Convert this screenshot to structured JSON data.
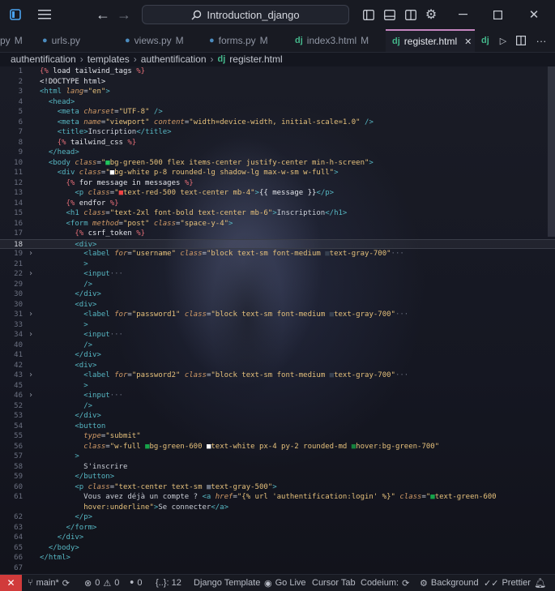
{
  "titlebar": {
    "search_text": "Introduction_django"
  },
  "tabs": [
    {
      "label": "py",
      "modified": "M",
      "icon": "python-icon"
    },
    {
      "label": "urls.py",
      "modified": "",
      "icon": "python-icon"
    },
    {
      "label": "views.py",
      "modified": "M",
      "icon": "python-icon"
    },
    {
      "label": "forms.py",
      "modified": "M",
      "icon": "python-icon"
    },
    {
      "label": "index3.html",
      "modified": "M",
      "icon": "django-icon"
    },
    {
      "label": "register.html",
      "modified": "",
      "icon": "django-icon",
      "active": true
    }
  ],
  "icons": {
    "django_prefix": "dj",
    "python_glyph": "●",
    "close": "✕"
  },
  "breadcrumb": [
    "authentification",
    "templates",
    "authentification",
    "register.html"
  ],
  "editor": {
    "lines": [
      {
        "n": "1",
        "html": "<span class='dt'>{%</span> <span class='k'>load tailwind_tags</span> <span class='dt'>%}</span>"
      },
      {
        "n": "2",
        "html": "<span class='k'>&lt;!DOCTYPE html&gt;</span>"
      },
      {
        "n": "3",
        "html": "<span class='tg'>&lt;html</span> <span class='at'>lang</span>=<span class='st'>\"en\"</span><span class='tg'>&gt;</span>"
      },
      {
        "n": "4",
        "html": "  <span class='tg'>&lt;head&gt;</span>"
      },
      {
        "n": "5",
        "html": "    <span class='tg'>&lt;meta</span> <span class='at'>charset</span>=<span class='st'>\"UTF-8\"</span> <span class='tg'>/&gt;</span>"
      },
      {
        "n": "6",
        "html": "    <span class='tg'>&lt;meta</span> <span class='at'>name</span>=<span class='st'>\"viewport\"</span> <span class='at'>content</span>=<span class='st'>\"width=device-width, initial-scale=1.0\"</span> <span class='tg'>/&gt;</span>"
      },
      {
        "n": "7",
        "html": "    <span class='tg'>&lt;title&gt;</span>Inscription<span class='tg'>&lt;/title&gt;</span>"
      },
      {
        "n": "8",
        "html": "    <span class='dt'>{%</span> <span class='k'>tailwind_css</span> <span class='dt'>%}</span>"
      },
      {
        "n": "9",
        "html": "  <span class='tg'>&lt;/head&gt;</span>"
      },
      {
        "n": "10",
        "html": "  <span class='tg'>&lt;body</span> <span class='at'>class</span>=<span class='st'>\"<span style='color:#22c55e'>■</span>bg-green-500 flex items-center justify-center min-h-screen\"</span><span class='tg'>&gt;</span>"
      },
      {
        "n": "11",
        "html": "    <span class='tg'>&lt;div</span> <span class='at'>class</span>=<span class='st'>\"<span style='color:#ffffff'>■</span>bg-white p-8 rounded-lg shadow-lg max-w-sm w-full\"</span><span class='tg'>&gt;</span>"
      },
      {
        "n": "12",
        "html": "      <span class='dt'>{%</span> <span class='k'>for message in messages</span> <span class='dt'>%}</span>"
      },
      {
        "n": "13",
        "html": "        <span class='tg'>&lt;p</span> <span class='at'>class</span>=<span class='st'>\"<span style='color:#ef4444'>■</span>text-red-500 text-center mb-4\"</span><span class='tg'>&gt;</span><span class='k'>{{ message }}</span><span class='tg'>&lt;/p&gt;</span>"
      },
      {
        "n": "14",
        "html": "      <span class='dt'>{%</span> <span class='k'>endfor</span> <span class='dt'>%}</span>"
      },
      {
        "n": "15",
        "html": "      <span class='tg'>&lt;h1</span> <span class='at'>class</span>=<span class='st'>\"text-2xl font-bold text-center mb-6\"</span><span class='tg'>&gt;</span>Inscription<span class='tg'>&lt;/h1&gt;</span>"
      },
      {
        "n": "16",
        "html": "      <span class='tg'>&lt;form</span> <span class='at'>method</span>=<span class='st'>\"post\"</span> <span class='at'>class</span>=<span class='st'>\"space-y-4\"</span><span class='tg'>&gt;</span>"
      },
      {
        "n": "17",
        "html": "        <span class='dt'>{%</span> <span class='k'>csrf_token</span> <span class='dt'>%}</span>"
      },
      {
        "n": "18",
        "html": "        <span class='tg'>&lt;div&gt;</span>",
        "current": true
      },
      {
        "n": "19",
        "fold": true,
        "html": "          <span class='tg'>&lt;label</span> <span class='at'>for</span>=<span class='st'>\"username\"</span> <span class='at'>class</span>=<span class='st'>\"block text-sm font-medium <span style='color:#374151'>■</span>text-gray-700\"</span><span style='color:#6b7080'>···</span>"
      },
      {
        "n": "21",
        "html": "          <span class='tg'>&gt;</span>"
      },
      {
        "n": "22",
        "fold": true,
        "html": "          <span class='tg'>&lt;input</span><span style='color:#6b7080'>···</span>"
      },
      {
        "n": "29",
        "html": "          <span class='tg'>/&gt;</span>"
      },
      {
        "n": "30",
        "html": "        <span class='tg'>&lt;/div&gt;</span>"
      },
      {
        "n": "30",
        "html": "        <span class='tg'>&lt;div&gt;</span>"
      },
      {
        "n": "31",
        "fold": true,
        "html": "          <span class='tg'>&lt;label</span> <span class='at'>for</span>=<span class='st'>\"password1\"</span> <span class='at'>class</span>=<span class='st'>\"block text-sm font-medium <span style='color:#374151'>■</span>text-gray-700\"</span><span style='color:#6b7080'>···</span>"
      },
      {
        "n": "33",
        "html": "          <span class='tg'>&gt;</span>"
      },
      {
        "n": "34",
        "fold": true,
        "html": "          <span class='tg'>&lt;input</span><span style='color:#6b7080'>···</span>"
      },
      {
        "n": "40",
        "html": "          <span class='tg'>/&gt;</span>"
      },
      {
        "n": "41",
        "html": "        <span class='tg'>&lt;/div&gt;</span>"
      },
      {
        "n": "42",
        "html": "        <span class='tg'>&lt;div&gt;</span>"
      },
      {
        "n": "43",
        "fold": true,
        "html": "          <span class='tg'>&lt;label</span> <span class='at'>for</span>=<span class='st'>\"password2\"</span> <span class='at'>class</span>=<span class='st'>\"block text-sm font-medium <span style='color:#374151'>■</span>text-gray-700\"</span><span style='color:#6b7080'>···</span>"
      },
      {
        "n": "45",
        "html": "          <span class='tg'>&gt;</span>"
      },
      {
        "n": "46",
        "fold": true,
        "html": "          <span class='tg'>&lt;input</span><span style='color:#6b7080'>···</span>"
      },
      {
        "n": "52",
        "html": "          <span class='tg'>/&gt;</span>"
      },
      {
        "n": "53",
        "html": "        <span class='tg'>&lt;/div&gt;</span>"
      },
      {
        "n": "54",
        "html": "        <span class='tg'>&lt;button</span>"
      },
      {
        "n": "55",
        "html": "          <span class='at'>type</span>=<span class='st'>\"submit\"</span>"
      },
      {
        "n": "56",
        "html": "          <span class='at'>class</span>=<span class='st'>\"w-full <span style='color:#16a34a'>■</span>bg-green-600 <span style='color:#ffffff'>■</span>text-white px-4 py-2 rounded-md <span style='color:#15803d'>■</span>hover:bg-green-700\"</span>"
      },
      {
        "n": "57",
        "html": "        <span class='tg'>&gt;</span>"
      },
      {
        "n": "58",
        "html": "          S'inscrire"
      },
      {
        "n": "59",
        "html": "        <span class='tg'>&lt;/button&gt;</span>"
      },
      {
        "n": "60",
        "html": "        <span class='tg'>&lt;p</span> <span class='at'>class</span>=<span class='st'>\"text-center text-sm <span style='color:#6b7280'>■</span>text-gray-500\"</span><span class='tg'>&gt;</span>"
      },
      {
        "n": "61",
        "html": "          Vous avez déjà un compte ? <span class='tg'>&lt;a</span> <span class='at'>href</span>=<span class='st'>\"{% url 'authentification:login' %}\"</span> <span class='at'>class</span>=<span class='st'>\"<span style='color:#16a34a'>■</span>text-green-600</span>"
      },
      {
        "n": "",
        "html": "          <span class='st'>hover:underline\"</span><span class='tg'>&gt;</span>Se connecter<span class='tg'>&lt;/a&gt;</span>"
      },
      {
        "n": "62",
        "html": "        <span class='tg'>&lt;/p&gt;</span>"
      },
      {
        "n": "63",
        "html": "      <span class='tg'>&lt;/form&gt;</span>"
      },
      {
        "n": "64",
        "html": "    <span class='tg'>&lt;/div&gt;</span>"
      },
      {
        "n": "65",
        "html": "  <span class='tg'>&lt;/body&gt;</span>"
      },
      {
        "n": "66",
        "html": "<span class='tg'>&lt;/html&gt;</span>"
      },
      {
        "n": "67",
        "html": ""
      }
    ]
  },
  "statusbar": {
    "branch": "main*",
    "errors": "0",
    "warnings": "0",
    "ports": "0",
    "position": "{..}: 12",
    "language": "Django Template",
    "golive": "Go Live",
    "cursortab": "Cursor Tab",
    "codeium": "Codeium:",
    "background": "Background",
    "prettier": "Prettier"
  },
  "colors": {
    "accent": "#c586c0",
    "remote": "#d13b3b",
    "django": "#44b78b",
    "python": "#4b8bbe"
  }
}
